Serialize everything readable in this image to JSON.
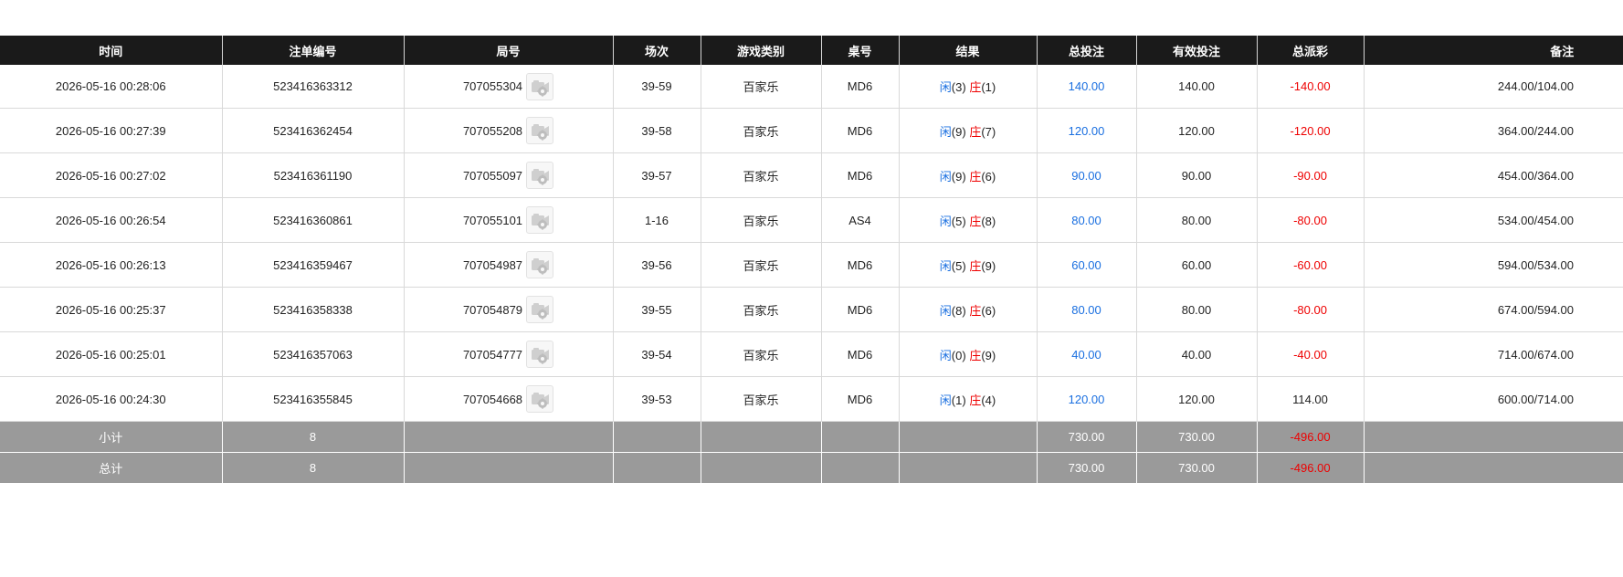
{
  "columns": [
    "时间",
    "注单编号",
    "局号",
    "场次",
    "游戏类别",
    "桌号",
    "结果",
    "总投注",
    "有效投注",
    "总派彩",
    "备注"
  ],
  "result_labels": {
    "player": "闲",
    "banker": "庄"
  },
  "icons": {
    "replay": "video-replay-icon"
  },
  "colors": {
    "header_bg": "#1a1a1a",
    "footer_bg": "#9a9a9a",
    "bet_blue": "#1a6fe0",
    "loss_red": "#ee0000"
  },
  "rows": [
    {
      "time": "2026-05-16 00:28:06",
      "bet_no": "523416363312",
      "round": "707055304",
      "shoe": "39-59",
      "game": "百家乐",
      "table": "MD6",
      "player": "(3)",
      "banker": "(1)",
      "total_bet": "140.00",
      "valid_bet": "140.00",
      "payout": "-140.00",
      "payout_neg": true,
      "remark": "244.00/104.00"
    },
    {
      "time": "2026-05-16 00:27:39",
      "bet_no": "523416362454",
      "round": "707055208",
      "shoe": "39-58",
      "game": "百家乐",
      "table": "MD6",
      "player": "(9)",
      "banker": "(7)",
      "total_bet": "120.00",
      "valid_bet": "120.00",
      "payout": "-120.00",
      "payout_neg": true,
      "remark": "364.00/244.00"
    },
    {
      "time": "2026-05-16 00:27:02",
      "bet_no": "523416361190",
      "round": "707055097",
      "shoe": "39-57",
      "game": "百家乐",
      "table": "MD6",
      "player": "(9)",
      "banker": "(6)",
      "total_bet": "90.00",
      "valid_bet": "90.00",
      "payout": "-90.00",
      "payout_neg": true,
      "remark": "454.00/364.00"
    },
    {
      "time": "2026-05-16 00:26:54",
      "bet_no": "523416360861",
      "round": "707055101",
      "shoe": "1-16",
      "game": "百家乐",
      "table": "AS4",
      "player": "(5)",
      "banker": "(8)",
      "total_bet": "80.00",
      "valid_bet": "80.00",
      "payout": "-80.00",
      "payout_neg": true,
      "remark": "534.00/454.00"
    },
    {
      "time": "2026-05-16 00:26:13",
      "bet_no": "523416359467",
      "round": "707054987",
      "shoe": "39-56",
      "game": "百家乐",
      "table": "MD6",
      "player": "(5)",
      "banker": "(9)",
      "total_bet": "60.00",
      "valid_bet": "60.00",
      "payout": "-60.00",
      "payout_neg": true,
      "remark": "594.00/534.00"
    },
    {
      "time": "2026-05-16 00:25:37",
      "bet_no": "523416358338",
      "round": "707054879",
      "shoe": "39-55",
      "game": "百家乐",
      "table": "MD6",
      "player": "(8)",
      "banker": "(6)",
      "total_bet": "80.00",
      "valid_bet": "80.00",
      "payout": "-80.00",
      "payout_neg": true,
      "remark": "674.00/594.00"
    },
    {
      "time": "2026-05-16 00:25:01",
      "bet_no": "523416357063",
      "round": "707054777",
      "shoe": "39-54",
      "game": "百家乐",
      "table": "MD6",
      "player": "(0)",
      "banker": "(9)",
      "total_bet": "40.00",
      "valid_bet": "40.00",
      "payout": "-40.00",
      "payout_neg": true,
      "remark": "714.00/674.00"
    },
    {
      "time": "2026-05-16 00:24:30",
      "bet_no": "523416355845",
      "round": "707054668",
      "shoe": "39-53",
      "game": "百家乐",
      "table": "MD6",
      "player": "(1)",
      "banker": "(4)",
      "total_bet": "120.00",
      "valid_bet": "120.00",
      "payout": "114.00",
      "payout_neg": false,
      "remark": "600.00/714.00"
    }
  ],
  "subtotal": {
    "label": "小计",
    "count": "8",
    "total_bet": "730.00",
    "valid_bet": "730.00",
    "payout": "-496.00"
  },
  "grandtotal": {
    "label": "总计",
    "count": "8",
    "total_bet": "730.00",
    "valid_bet": "730.00",
    "payout": "-496.00"
  }
}
